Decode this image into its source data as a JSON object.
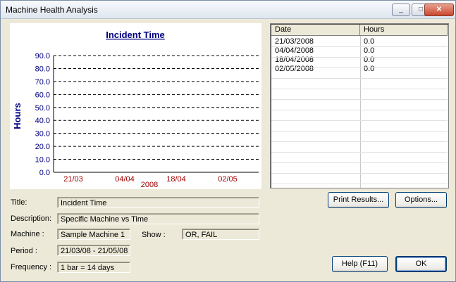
{
  "window": {
    "title": "Machine Health Analysis"
  },
  "chart_data": {
    "type": "bar",
    "title": "Incident Time",
    "ylabel": "Hours",
    "xlabel": "2008",
    "categories": [
      "21/03",
      "04/04",
      "18/04",
      "02/05"
    ],
    "values": [
      0.0,
      0.0,
      0.0,
      0.0
    ],
    "ylim": [
      0,
      90
    ],
    "yticks": [
      "0.0",
      "10.0",
      "20.0",
      "30.0",
      "40.0",
      "50.0",
      "60.0",
      "70.0",
      "80.0",
      "90.0"
    ],
    "grid": true,
    "colors": {
      "title": "#000080",
      "tick": "#000080",
      "category": "#a00000",
      "grid": "#000000"
    }
  },
  "results": {
    "columns": [
      "Date",
      "Hours"
    ],
    "rows": [
      {
        "date": "21/03/2008",
        "hours": "0.0"
      },
      {
        "date": "04/04/2008",
        "hours": "0.0"
      },
      {
        "date": "18/04/2008",
        "hours": "0.0"
      },
      {
        "date": "02/05/2008",
        "hours": "0.0"
      }
    ]
  },
  "form": {
    "title_label": "Title:",
    "title_value": "Incident Time",
    "description_label": "Description:",
    "description_value": "Specific Machine vs Time",
    "machine_label": "Machine :",
    "machine_value": "Sample Machine 1",
    "show_label": "Show :",
    "show_value": "OR, FAIL",
    "period_label": "Period :",
    "period_value": "21/03/08 - 21/05/08",
    "frequency_label": "Frequency :",
    "frequency_value": "1 bar = 14 days"
  },
  "buttons": {
    "print": "Print Results...",
    "options": "Options...",
    "help": "Help (F11)",
    "ok": "OK"
  },
  "titlebar_buttons": {
    "minimize": "_",
    "maximize": "□",
    "close": "✕"
  }
}
